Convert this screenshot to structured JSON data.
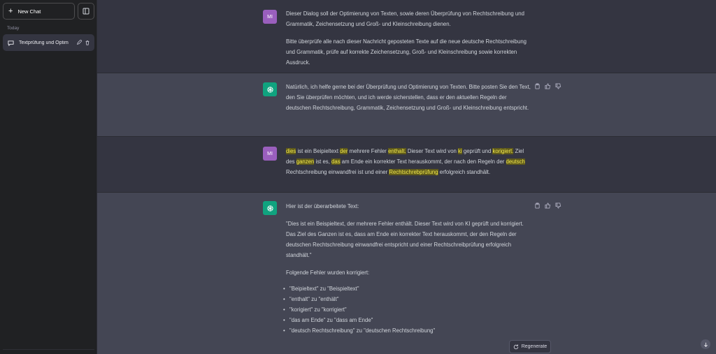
{
  "sidebar": {
    "new_chat_label": "New Chat",
    "section_label": "Today",
    "conversations": [
      {
        "title": "Textprüfung und Optim"
      }
    ]
  },
  "messages": [
    {
      "role": "user",
      "avatar": "MI",
      "paragraphs": [
        "Dieser Dialog soll der Optimierung von Texten, sowie deren Überprüfung von Rechtschreibung und Grammatik, Zeichensetzung und Groß- und Kleinschreibung dienen.",
        "Bitte überprüfe alle nach dieser Nachricht geposteten Texte auf die neue deutsche Rechtschreibung und Grammatik, prüfe auf korrekte Zeichensetzung, Groß- und Kleinschreibung sowie korrekten Ausdruck."
      ]
    },
    {
      "role": "assistant",
      "paragraphs": [
        "Natürlich, ich helfe gerne bei der Überprüfung und Optimierung von Texten. Bitte posten Sie den Text, den Sie überprüfen möchten, und ich werde sicherstellen, dass er den aktuellen Regeln der deutschen Rechtschreibung, Grammatik, Zeichensetzung und Groß- und Kleinschreibung entspricht."
      ]
    },
    {
      "role": "user",
      "avatar": "MI",
      "segments": [
        {
          "t": "dies",
          "hl": true
        },
        {
          "t": " ist ein Beipieltext "
        },
        {
          "t": "der",
          "hl": true
        },
        {
          "t": " mehrere Fehler "
        },
        {
          "t": "enthalt.",
          "hl": true
        },
        {
          "t": " Dieser Text wird von "
        },
        {
          "t": "ki",
          "hl": true
        },
        {
          "t": " geprüft und "
        },
        {
          "t": "korigiert.",
          "hl": true
        },
        {
          "t": " Ziel des "
        },
        {
          "t": "ganzen",
          "hl": true
        },
        {
          "t": " ist es, "
        },
        {
          "t": "das",
          "hl": true
        },
        {
          "t": " am Ende ein korrekter Text herauskommt, der nach den Regeln der "
        },
        {
          "t": "deutsch",
          "hl": true
        },
        {
          "t": " Rechtschreibung einwandfrei ist und einer "
        },
        {
          "t": "Rechtschrebprüfung",
          "hl": true
        },
        {
          "t": " erfolgreich standhält."
        }
      ]
    },
    {
      "role": "assistant",
      "intro": "Hier ist der überarbeitete Text:",
      "corrected": "\"Dies ist ein Beispieltext, der mehrere Fehler enthält. Dieser Text wird von KI geprüft und korrigiert. Das Ziel des Ganzen ist es, dass am Ende ein korrekter Text herauskommt, der den Regeln der deutschen Rechtschreibung einwandfrei entspricht und einer Rechtschreibprüfung erfolgreich standhält.\"",
      "fixes_title": "Folgende Fehler wurden korrigiert:",
      "fixes": [
        "\"Beipieltext\" zu \"Beispieltext\"",
        "\"enthalt\" zu \"enthält\"",
        "\"korigiert\" zu \"korrigiert\"",
        "\"das am Ende\" zu \"dass am Ende\"",
        "\"deutsch Rechtschreibung\" zu \"deutschen Rechtschreibung\""
      ]
    }
  ],
  "regenerate_label": "Regenerate",
  "icons": {
    "new_chat": "plus-icon",
    "sidebar_toggle": "sidebar-toggle-icon",
    "conversation": "chat-bubble-icon",
    "edit": "pencil-icon",
    "delete": "trash-icon",
    "gpt_avatar": "openai-logo-icon",
    "copy": "clipboard-icon",
    "like": "thumbs-up-icon",
    "dislike": "thumbs-down-icon",
    "regenerate": "refresh-icon",
    "scroll_down": "arrow-down-icon"
  },
  "colors": {
    "sidebar_bg": "#202123",
    "user_bg": "#343541",
    "assistant_bg": "#444654",
    "gpt_green": "#10a37f",
    "user_avatar": "#9a5fbd",
    "highlight": "#f2e94e"
  }
}
